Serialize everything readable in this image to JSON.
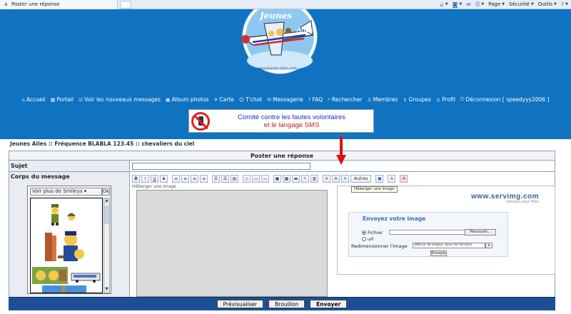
{
  "browser": {
    "tab_title": "Poster une réponse",
    "commands": [
      {
        "icon": "home-icon",
        "label": ""
      },
      {
        "icon": "feed-icon",
        "label": ""
      },
      {
        "icon": "mail-icon",
        "label": ""
      },
      {
        "icon": "print-icon",
        "label": ""
      },
      {
        "icon": "page-menu-icon",
        "label": "Page"
      },
      {
        "icon": "security-icon",
        "label": "Sécurité"
      },
      {
        "icon": "tools-icon",
        "label": "Outils"
      },
      {
        "icon": "help-icon",
        "label": ""
      }
    ]
  },
  "site": {
    "logo_name": "Jeunes Ailes",
    "logo_url": "www.jeunes-ailes.com",
    "nav": [
      {
        "icon": "home-icon",
        "label": "Accueil"
      },
      {
        "icon": "portal-icon",
        "label": "Portail"
      },
      {
        "icon": "checkbox-icon",
        "label": "Voir les nouveaux messages"
      },
      {
        "icon": "photo-icon",
        "label": "Album photos"
      },
      {
        "icon": "map-icon",
        "label": "Carte"
      },
      {
        "icon": "chat-icon",
        "label": "T'chat"
      },
      {
        "icon": "messaging-icon",
        "label": "Messagerie"
      },
      {
        "icon": "faq-icon",
        "label": "FAQ"
      },
      {
        "icon": "search-icon",
        "label": "Rechercher"
      },
      {
        "icon": "member-icon",
        "label": "Membres"
      },
      {
        "icon": "groups-icon",
        "label": "Groupes"
      },
      {
        "icon": "profile-icon",
        "label": "Profil"
      },
      {
        "icon": "logout-icon",
        "label": "Déconnexion [ speedyyy2006 ]"
      }
    ],
    "banner_line1": "Comité contre les fautes volontaires",
    "banner_line2": "et le langage SMS"
  },
  "page": {
    "breadcrumb": "Jeunes Ailes :: Fréquence BLABLA 123.45 :: chevaliers du ciel",
    "form_title": "Poster une réponse",
    "subject_label": "Sujet",
    "subject_value": "",
    "body_label": "Corps du message",
    "smiley_select": "Voir plus de Smileys",
    "smiley_ok": "Ok",
    "toolbar_buttons": [
      "B",
      "I",
      "U",
      "S",
      "≡",
      "≡",
      "≡",
      "≡",
      "☰",
      "☰",
      "▤",
      "◇",
      "▭",
      "▭",
      "▣",
      "▦",
      "▬",
      "✎",
      "▥",
      "A",
      "A",
      "A",
      "Autres",
      "●",
      "A",
      "A"
    ],
    "heberger_label": "Héberger une image",
    "tooltip": "Héberger une image",
    "servimg": {
      "logo": "www.servimg.com",
      "tagline": "Upload your files",
      "title": "Envoyez votre image",
      "option_file": "Fichier",
      "option_url": "url",
      "browse": "Parcourir...",
      "resize_label": "Redimensionner l'image",
      "resize_value": "800 px de largeur (pour les forums)",
      "send": "Envoyer"
    },
    "footer_buttons": [
      "Prévisualiser",
      "Brouillon",
      "Envoyer"
    ]
  },
  "colors": {
    "site_bg": "#0f73c2",
    "footer_bg": "#1e4f96",
    "arrow": "#e01010"
  }
}
